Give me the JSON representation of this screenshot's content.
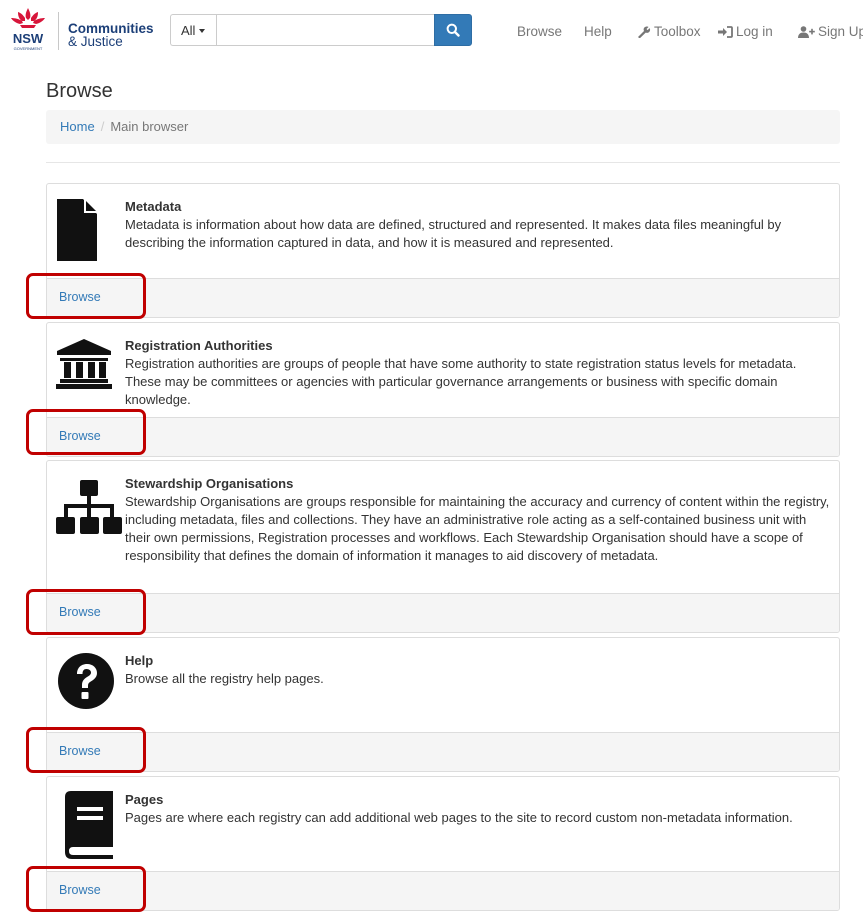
{
  "brand": {
    "logo_text": "NSW",
    "logo_subtext": "GOVERNMENT",
    "line1": "Communities",
    "line2": "& Justice"
  },
  "search": {
    "dropdown_value": "All",
    "input_value": "",
    "placeholder": ""
  },
  "nav": {
    "browse": "Browse",
    "help": "Help",
    "toolbox": "Toolbox",
    "login": "Log in",
    "signup": "Sign Up"
  },
  "page": {
    "title": "Browse",
    "breadcrumb": {
      "home": "Home",
      "separator": "/",
      "current": "Main browser"
    }
  },
  "panels": [
    {
      "title": "Metadata",
      "description": "Metadata is information about how data are defined, structured and represented. It makes data files meaningful by describing the information captured in data, and how it is measured and represented.",
      "link": "Browse",
      "icon": "document-icon"
    },
    {
      "title": "Registration Authorities",
      "description": "Registration authorities are groups of people that have some authority to state registration status levels for metadata. These may be committees or agencies with particular governance arrangements or business with specific domain knowledge.",
      "link": "Browse",
      "icon": "institution-icon"
    },
    {
      "title": "Stewardship Organisations",
      "description": "Stewardship Organisations are groups responsible for maintaining the accuracy and currency of content within the registry, including metadata, files and collections. They have an administrative role acting as a self-contained business unit with their own permissions, Registration processes and workflows. Each Stewardship Organisation should have a scope of responsibility that defines the domain of information it manages to aid discovery of metadata.",
      "link": "Browse",
      "icon": "sitemap-icon"
    },
    {
      "title": "Help",
      "description": "Browse all the registry help pages.",
      "link": "Browse",
      "icon": "question-circle-icon"
    },
    {
      "title": "Pages",
      "description": "Pages are where each registry can add additional web pages to the site to record custom non-metadata information.",
      "link": "Browse",
      "icon": "book-icon"
    }
  ],
  "colors": {
    "link": "#337ab7",
    "brand": "#1c3f78",
    "nsw_red": "#d7153a",
    "highlight": "#c00000"
  }
}
